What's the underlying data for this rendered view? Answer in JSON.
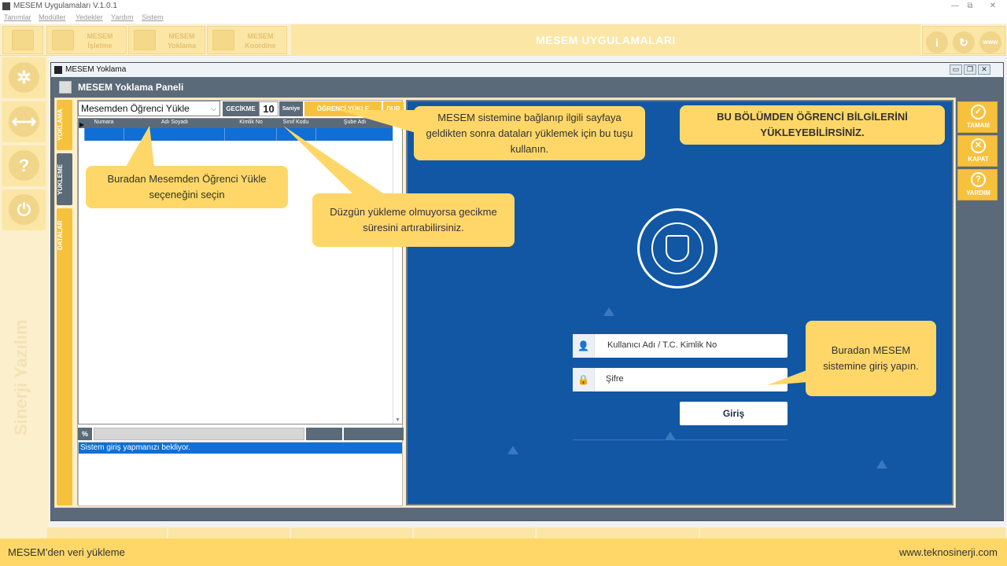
{
  "app": {
    "title": "MESEM Uygulamaları V.1.0.1",
    "menu": [
      "Tanımlar",
      "Modüller",
      "Yedekler",
      "Yardım",
      "Sistem"
    ],
    "window_controls": [
      "—",
      "⧉",
      "✕"
    ]
  },
  "ribbon": {
    "buttons": [
      {
        "label": "MESEM İşletme"
      },
      {
        "label": "MESEM Yoklama"
      },
      {
        "label": "MESEM Koordine"
      }
    ],
    "title": "MESEM UYGULAMALARI",
    "icons": [
      "info-icon",
      "refresh-icon",
      "www-icon"
    ],
    "icon_glyphs": [
      "i",
      "↻",
      "www"
    ]
  },
  "leftnav": {
    "icons": [
      "settings-icon",
      "swap-icon",
      "help-icon",
      "power-icon"
    ],
    "glyphs": [
      "✲",
      "⟷",
      "?",
      "⏻"
    ],
    "watermark": "Sinerji Yazılım"
  },
  "child_window": {
    "title": "MESEM Yoklama",
    "controls": [
      "▭",
      "❐",
      "✕"
    ]
  },
  "panel": {
    "title": "MESEM Yoklama Paneli",
    "tabs": [
      "YOKLAMA",
      "YÜKLEME",
      "DATALAR"
    ]
  },
  "loader": {
    "source_select": "Mesemden Öğrenci Yükle",
    "delay_label": "GECİKME",
    "delay_value": "10",
    "delay_unit": "Saniye",
    "load_button": "ÖĞRENCİ YÜKLE",
    "stop_button": "DUR",
    "grid_columns": [
      "Numara",
      "Adı Soyadı",
      "Kimlik No",
      "Sınıf Kodu",
      "Şube Adı"
    ],
    "percent_label": "%",
    "log_message": "Sistem giriş yapmanızı bekliyor."
  },
  "login": {
    "username_placeholder": "Kullanıcı Adı / T.C. Kimlik No",
    "password_placeholder": "Şifre",
    "submit_label": "Giriş"
  },
  "actions": [
    {
      "label": "TAMAM",
      "glyph": "✓"
    },
    {
      "label": "KAPAT",
      "glyph": "✕"
    },
    {
      "label": "YARDIM",
      "glyph": "?"
    }
  ],
  "callouts": {
    "select_hint": "Buradan Mesemden Öğrenci Yükle seçeneğini seçin",
    "delay_hint": "Düzgün yükleme olmuyorsa gecikme süresini artırabilirsiniz.",
    "load_hint": "MESEM sistemine bağlanıp ilgili sayfaya geldikten sonra dataları yüklemek için bu tuşu kullanın.",
    "section_hint": "BU BÖLÜMDEN ÖĞRENCİ BİLGİLERİNİ YÜKLEYEBİLİRSİNİZ.",
    "login_hint": "Buradan MESEM sistemine giriş yapın."
  },
  "footer": {
    "left": "MESEM’den veri yükleme",
    "right": "www.teknosinerji.com"
  },
  "colors": {
    "accent": "#f6c23e",
    "callout": "#fed768",
    "panel": "#5b6a78",
    "browser": "#1257a4",
    "selection": "#0f6fd6"
  }
}
